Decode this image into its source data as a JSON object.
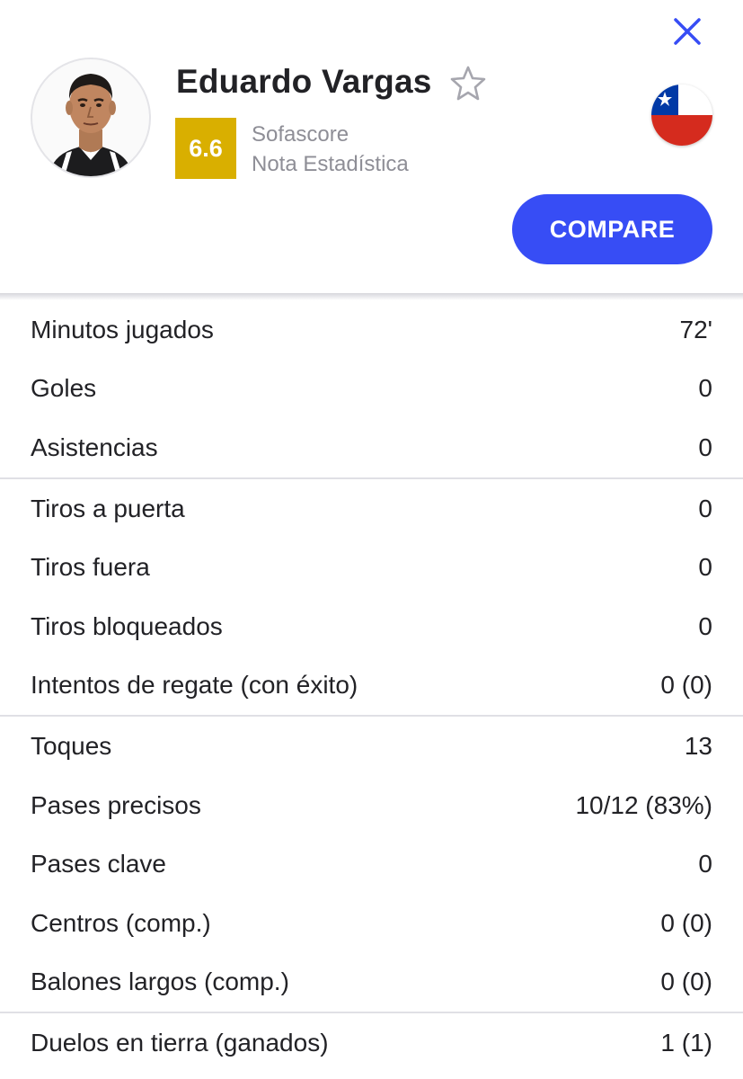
{
  "player": {
    "name": "Eduardo Vargas",
    "rating": "6.6",
    "rating_source": "Sofascore",
    "rating_label": "Nota Estadística",
    "rating_color": "#d9af00",
    "country_flag": "chile-flag-icon"
  },
  "actions": {
    "compare_label": "COMPARE",
    "compare_color": "#374df5",
    "close_icon": "close-icon",
    "favorite_icon": "star-outline-icon"
  },
  "stats": [
    {
      "label": "Minutos jugados",
      "value": "72'"
    },
    {
      "label": "Goles",
      "value": "0"
    },
    {
      "label": "Asistencias",
      "value": "0"
    },
    {
      "label": "Tiros a puerta",
      "value": "0"
    },
    {
      "label": "Tiros fuera",
      "value": "0"
    },
    {
      "label": "Tiros bloqueados",
      "value": "0"
    },
    {
      "label": "Intentos de regate (con éxito)",
      "value": "0 (0)"
    },
    {
      "label": "Toques",
      "value": "13"
    },
    {
      "label": "Pases precisos",
      "value": "10/12 (83%)"
    },
    {
      "label": "Pases clave",
      "value": "0"
    },
    {
      "label": "Centros (comp.)",
      "value": "0 (0)"
    },
    {
      "label": "Balones largos (comp.)",
      "value": "0 (0)"
    },
    {
      "label": "Duelos en tierra (ganados)",
      "value": "1 (1)"
    }
  ]
}
